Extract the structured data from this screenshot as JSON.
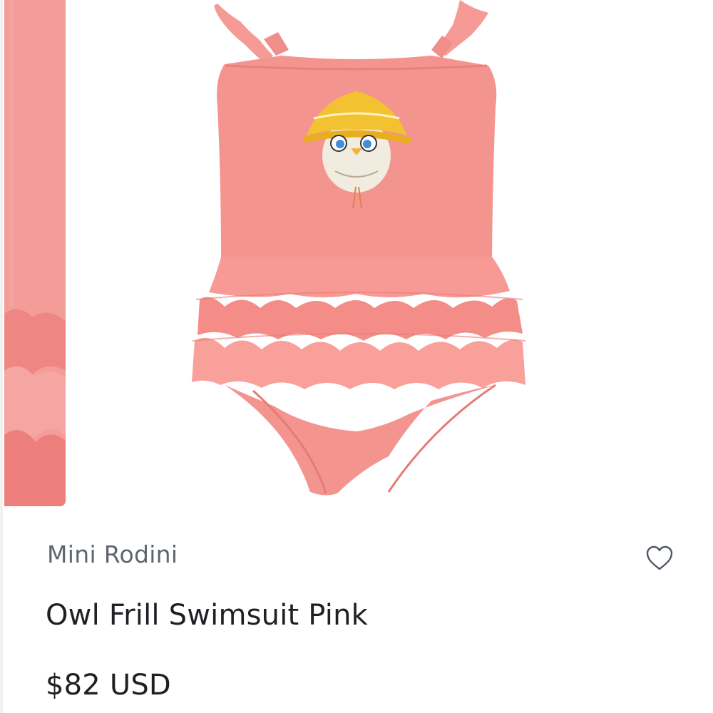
{
  "gallery": {
    "previous_image": "product-image-thumbnail",
    "current_image": "owl-frill-swimsuit-photo",
    "colors": {
      "swimsuit": "#f4948f",
      "swimsuit_shadow": "#e8807c",
      "hat": "#f2c230"
    }
  },
  "product": {
    "brand": "Mini Rodini",
    "title": "Owl Frill Swimsuit Pink",
    "price": "$82 USD",
    "favorite_icon": "heart-outline-icon"
  }
}
